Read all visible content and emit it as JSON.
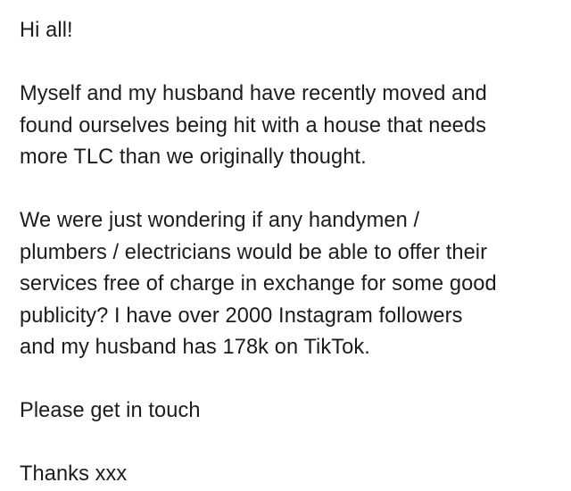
{
  "post": {
    "greeting": "Hi all!",
    "paragraph_1": {
      "line_1": "Myself and my husband have recently moved and",
      "line_2": "found ourselves being hit with a house that needs",
      "line_3": "more TLC than we originally thought."
    },
    "paragraph_2": {
      "line_1": "We were just wondering if any handymen /",
      "line_2": "plumbers / electricians would be able to offer their",
      "line_3": "services free of charge in exchange for some good",
      "line_4": "publicity? I have over 2000 Instagram followers",
      "line_5": "and my husband has 178k on TikTok."
    },
    "call_to_action": "Please get in touch",
    "signoff": "Thanks xxx"
  }
}
